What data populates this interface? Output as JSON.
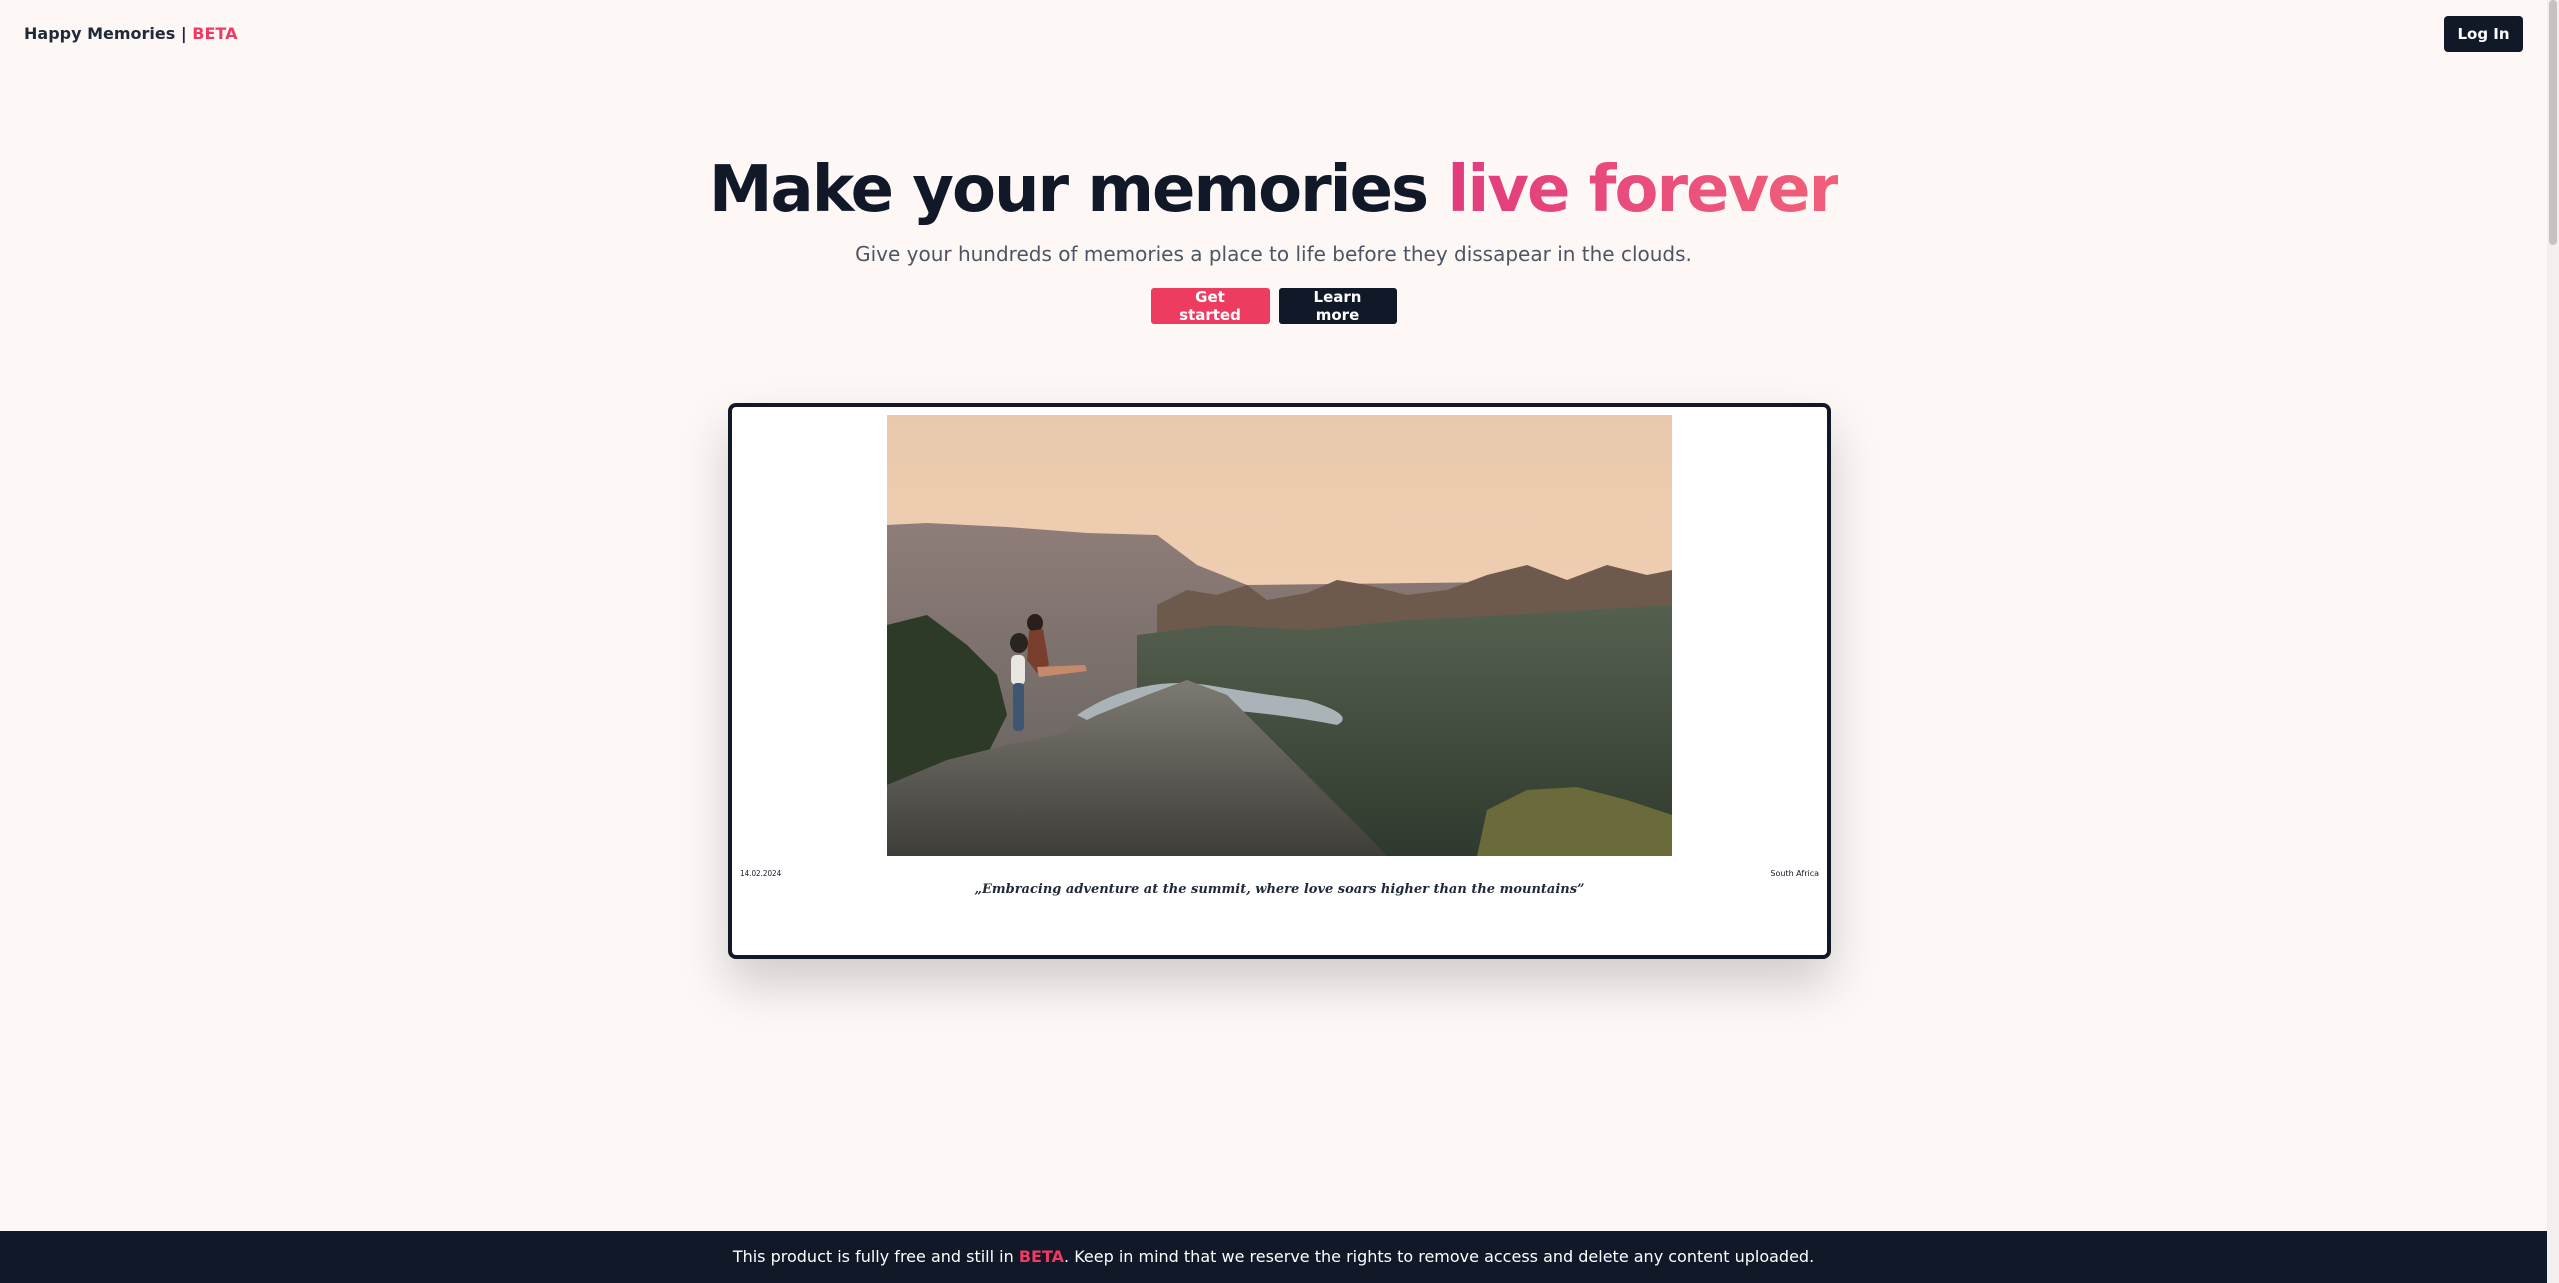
{
  "header": {
    "brand_name": "Happy Memories | ",
    "brand_badge": "BETA",
    "login_label": "Log In"
  },
  "hero": {
    "title_main": "Make your memories ",
    "title_accent": "live forever",
    "subtitle": "Give your hundreds of memories a place to life before they dissapear in the clouds.",
    "primary_cta": "Get started",
    "secondary_cta": "Learn more"
  },
  "memory_card": {
    "photo_alt": "couple-on-mountain-cliff",
    "date": "14.02.2024",
    "location": "South Africa",
    "quote": "„Embracing adventure at the summit, where love soars higher than the mountains”"
  },
  "footer": {
    "text_before": "This product is fully free and still in ",
    "badge": "BETA",
    "text_after": ". Keep in mind that we reserve the rights to remove access and delete any content uploaded."
  },
  "colors": {
    "background": "#fdf8f6",
    "dark": "#111827",
    "accent": "#ee3b60",
    "accent_gradient_start": "#e23b7e",
    "accent_gradient_end": "#f0607a"
  }
}
